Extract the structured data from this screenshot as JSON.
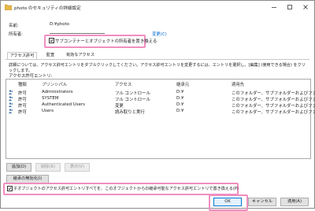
{
  "window": {
    "title": "photo のセキュリティの詳細設定",
    "minimize_icon": "minimize-icon",
    "maximize_icon": "maximize-icon",
    "close_icon": "close-icon"
  },
  "info": {
    "name_label": "名前:",
    "name_value": "D:¥photo",
    "owner_label": "所有者:",
    "owner_change_link": "変更(C)",
    "replace_owner_label": "サブコンテナーとオブジェクトの所有者を置き換える"
  },
  "tabs": [
    {
      "label": "アクセス許可"
    },
    {
      "label": "監査"
    },
    {
      "label": "有効なアクセス"
    }
  ],
  "description": "詳細については、アクセス許可エントリをダブルクリックしてください。アクセス許可エントリを変更するには、エントリを選択し、[編集] (使用できる場合) をクリックします。",
  "entries_label": "アクセス許可エントリ:",
  "columns": {
    "type": "種類",
    "principal": "プリンシパル",
    "access": "アクセス",
    "inherited_from": "継承元",
    "applies_to": "適用先"
  },
  "entries": [
    {
      "type": "許可",
      "principal": "Administrators",
      "access": "フル コントロール",
      "inherited_from": "D:¥",
      "applies_to": "このフォルダー、サブフォルダーおよびファイル"
    },
    {
      "type": "許可",
      "principal": "SYSTEM",
      "access": "フル コントロール",
      "inherited_from": "D:¥",
      "applies_to": "このフォルダー、サブフォルダーおよびファイル"
    },
    {
      "type": "許可",
      "principal": "Authenticated Users",
      "access": "変更",
      "inherited_from": "D:¥",
      "applies_to": "このフォルダー、サブフォルダーおよびファイル"
    },
    {
      "type": "許可",
      "principal": "Users",
      "access": "読み取りと実行",
      "inherited_from": "D:¥",
      "applies_to": "このフォルダー、サブフォルダーおよびファイル"
    }
  ],
  "actions": {
    "add": "追加(D)",
    "remove": "削除(R)",
    "view": "表示(V)",
    "disable_inheritance": "継承の無効化(I)"
  },
  "replace_child_label": "子オブジェクトのアクセス許可エントリすべてを、このオブジェクトからの継承可能なアクセス許可エントリで置き換える(P)",
  "footer": {
    "ok": "OK",
    "cancel": "キャンセル",
    "apply": "適用(A)"
  },
  "colors": {
    "highlight": "#f08fc0",
    "accent": "#0078d7",
    "user_icon": "#3b6ea5"
  }
}
